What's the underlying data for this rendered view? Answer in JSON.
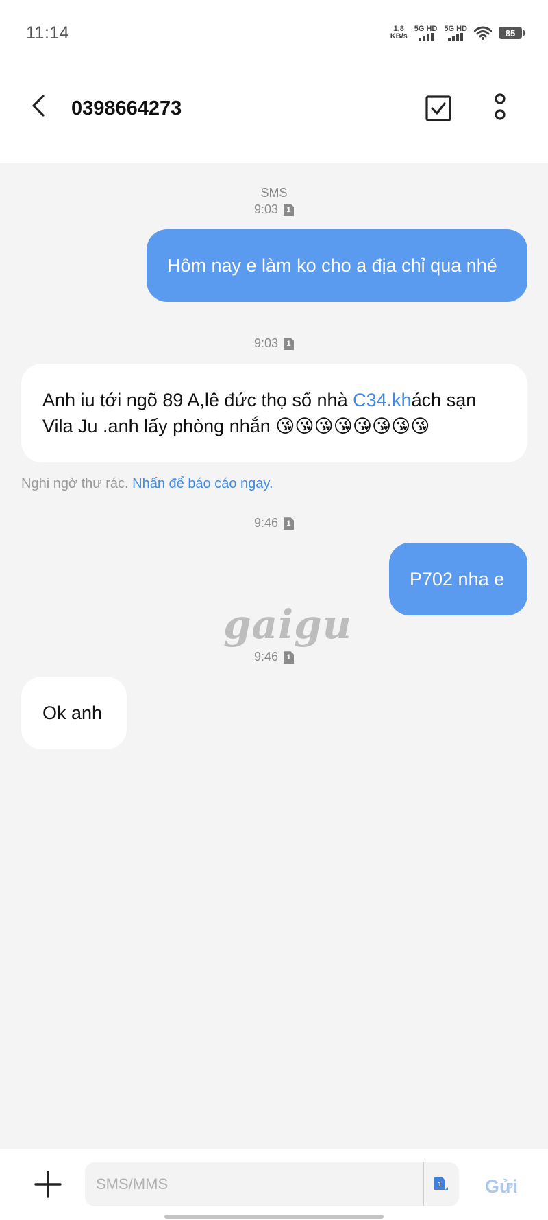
{
  "status_bar": {
    "time": "11:14",
    "net_speed_value": "1,8",
    "net_speed_unit": "KB/s",
    "sim1_label": "5G HD",
    "sim2_label": "5G HD",
    "battery": "85",
    "icons": [
      "signal-icon",
      "signal-icon",
      "wifi-icon",
      "battery-icon"
    ]
  },
  "header": {
    "contact": "0398664273",
    "icons": [
      "back-arrow-icon",
      "checkbox-icon",
      "more-vertical-icon"
    ]
  },
  "conversation": {
    "channel_label": "SMS",
    "messages": [
      {
        "time": "9:03",
        "direction": "outgoing",
        "text": "Hôm nay e làm ko cho a địa chỉ qua nhé"
      },
      {
        "time": "9:03",
        "direction": "incoming",
        "text_before_link": "Anh iu tới ngõ 89 A,lê đức thọ số nhà ",
        "link_text": "C34.kh",
        "text_after_link": "ách sạn Vila Ju .anh lấy phòng nhắn 😘😘😘😘😘😘😘😘"
      },
      {
        "time": "9:46",
        "direction": "outgoing",
        "text": "P702 nha e"
      },
      {
        "time": "9:46",
        "direction": "incoming",
        "text": "Ok anh"
      }
    ],
    "sim_badge": "1",
    "spam_notice": "Nghi ngờ thư rác.",
    "spam_report_link": "Nhấn để báo cáo ngay",
    "spam_period": ".",
    "watermark": "gaigu"
  },
  "composer": {
    "placeholder": "SMS/MMS",
    "sim_badge": "1",
    "send_label": "Gửi",
    "icons": [
      "plus-icon",
      "sim-card-icon"
    ]
  },
  "colors": {
    "outgoing_bubble": "#5a9bf0",
    "incoming_bubble": "#ffffff",
    "link": "#3f8ae6",
    "background": "#f4f4f4"
  }
}
